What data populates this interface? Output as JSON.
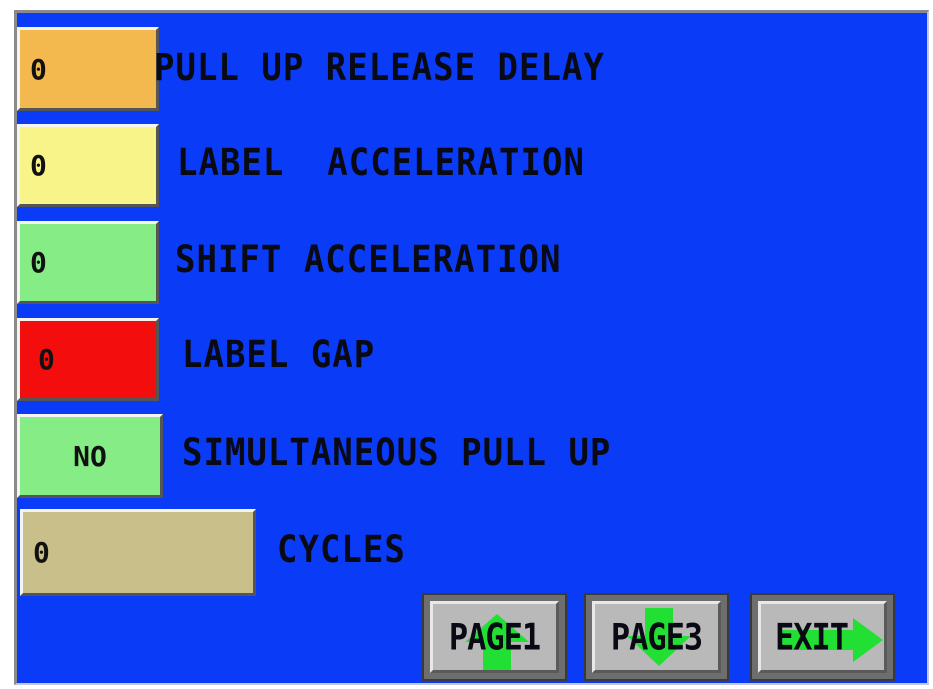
{
  "fields": [
    {
      "value": "0",
      "label": "PULL UP RELEASE DELAY",
      "color": "#f4b94e"
    },
    {
      "value": "0",
      "label": "LABEL  ACCELERATION",
      "color": "#f8f48a"
    },
    {
      "value": "0",
      "label": "SHIFT ACCELERATION",
      "color": "#86ec86"
    },
    {
      "value": "0",
      "label": "LABEL GAP",
      "color": "#f40d0d"
    },
    {
      "value": "NO",
      "label": "SIMULTANEOUS PULL UP",
      "color": "#86ec86"
    },
    {
      "value": "0",
      "label": "CYCLES",
      "color": "#c9bf8a"
    }
  ],
  "buttons": [
    {
      "label": "PAGE1",
      "icon": "arrow-up-icon"
    },
    {
      "label": "PAGE3",
      "icon": "arrow-down-icon"
    },
    {
      "label": "EXIT",
      "icon": "arrow-right-icon"
    }
  ],
  "colors": {
    "background": "#0a3bf7",
    "arrow": "#22e033"
  }
}
